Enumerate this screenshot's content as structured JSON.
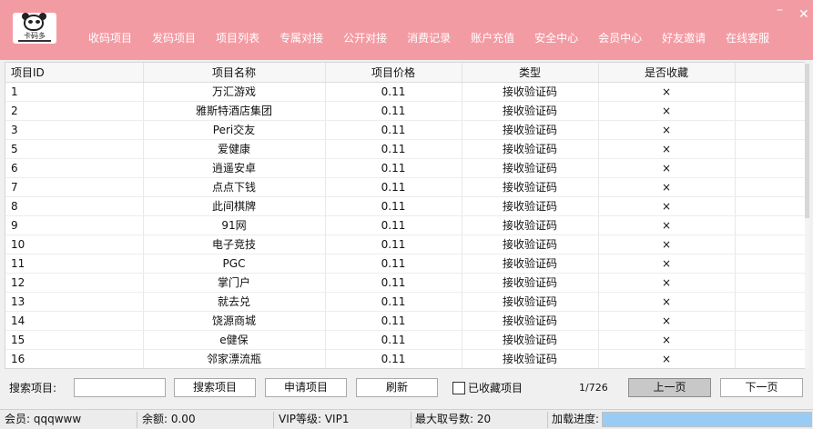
{
  "header": {
    "logo_text": "卡码多",
    "nav": [
      "收码项目",
      "发码项目",
      "项目列表",
      "专属对接",
      "公开对接",
      "消费记录",
      "账户充值",
      "安全中心",
      "会员中心",
      "好友邀请",
      "在线客服"
    ],
    "minimize_symbol": "–",
    "close_symbol": "✕"
  },
  "table": {
    "columns": [
      "项目ID",
      "项目名称",
      "项目价格",
      "类型",
      "是否收藏"
    ],
    "rows": [
      [
        "1",
        "万汇游戏",
        "0.11",
        "接收验证码",
        "×"
      ],
      [
        "2",
        "雅斯特酒店集团",
        "0.11",
        "接收验证码",
        "×"
      ],
      [
        "3",
        "Peri交友",
        "0.11",
        "接收验证码",
        "×"
      ],
      [
        "5",
        "爱健康",
        "0.11",
        "接收验证码",
        "×"
      ],
      [
        "6",
        "逍遥安卓",
        "0.11",
        "接收验证码",
        "×"
      ],
      [
        "7",
        "点点下钱",
        "0.11",
        "接收验证码",
        "×"
      ],
      [
        "8",
        "此间棋牌",
        "0.11",
        "接收验证码",
        "×"
      ],
      [
        "9",
        "91网",
        "0.11",
        "接收验证码",
        "×"
      ],
      [
        "10",
        "电子竞技",
        "0.11",
        "接收验证码",
        "×"
      ],
      [
        "11",
        "PGC",
        "0.11",
        "接收验证码",
        "×"
      ],
      [
        "12",
        "掌门户",
        "0.11",
        "接收验证码",
        "×"
      ],
      [
        "13",
        "就去兑",
        "0.11",
        "接收验证码",
        "×"
      ],
      [
        "14",
        "饶源商城",
        "0.11",
        "接收验证码",
        "×"
      ],
      [
        "15",
        "e健保",
        "0.11",
        "接收验证码",
        "×"
      ],
      [
        "16",
        "邻家漂流瓶",
        "0.11",
        "接收验证码",
        "×"
      ]
    ]
  },
  "search": {
    "label": "搜索项目:",
    "value": "",
    "search_button": "搜索项目",
    "apply_button": "申请项目",
    "refresh_button": "刷新",
    "favorites_label": "已收藏项目",
    "favorites_checked": false,
    "page_info": "1/726",
    "prev_button": "上一页",
    "next_button": "下一页"
  },
  "status": {
    "member": "会员: qqqwww",
    "balance": "余额: 0.00",
    "vip": "VIP等级: VIP1",
    "max_fetch": "最大取号数: 20",
    "progress_label": "加载进度:",
    "progress_value": 1.0
  },
  "colors": {
    "header_bg": "#f39ba3",
    "progress_fill": "#99ccf5"
  }
}
